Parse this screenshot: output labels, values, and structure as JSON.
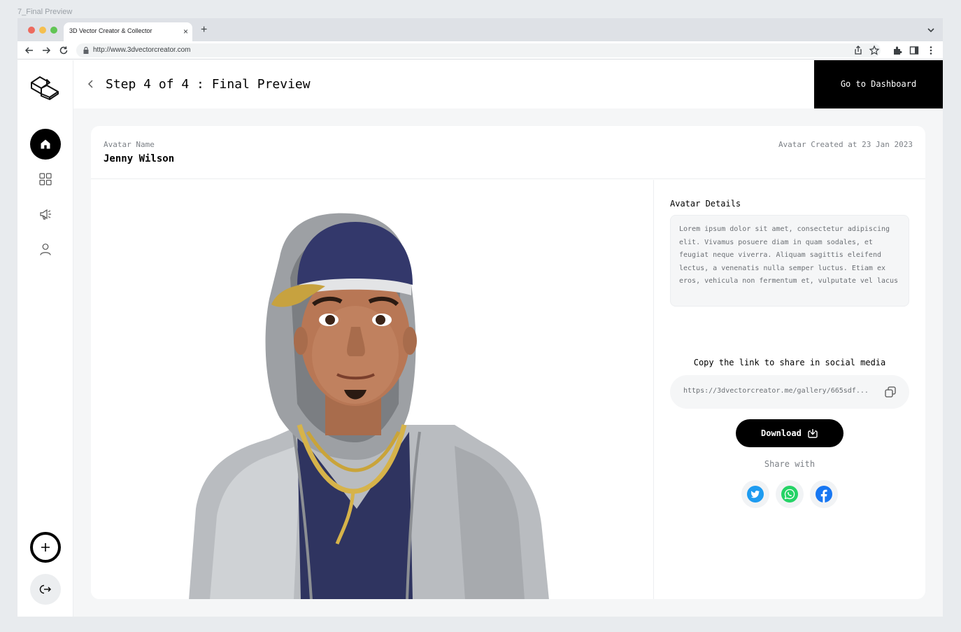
{
  "frame_label": "7_Final Preview",
  "browser": {
    "tab_title": "3D Vector Creator & Collector",
    "tab_close": "×",
    "new_tab": "+",
    "url": "http://www.3dvectorcreator.com"
  },
  "colors": {
    "accent": "#000000",
    "background": "#f5f6f7",
    "twitter": "#1d9bf0",
    "whatsapp": "#25d366",
    "facebook": "#1877f2"
  },
  "sidebar": {
    "items": [
      {
        "icon": "home-icon",
        "active": true
      },
      {
        "icon": "grid-icon",
        "active": false
      },
      {
        "icon": "megaphone-icon",
        "active": false
      },
      {
        "icon": "user-icon",
        "active": false
      }
    ],
    "add_icon": "plus-icon",
    "logout_icon": "logout-icon"
  },
  "header": {
    "title": "Step 4 of 4 : Final Preview",
    "dashboard_button": "Go to Dashboard"
  },
  "avatar": {
    "name_label": "Avatar Name",
    "name": "Jenny Wilson",
    "created": "Avatar Created at 23 Jan 2023"
  },
  "details": {
    "title": "Avatar Details",
    "description": "Lorem ipsum dolor sit amet, consectetur adipiscing elit. Vivamus posuere diam in quam sodales, et feugiat neque viverra. Aliquam sagittis eleifend lectus, a venenatis nulla semper luctus. Etiam ex eros, vehicula non fermentum et, vulputate vel lacus",
    "share_prompt": "Copy the link to share in social media",
    "share_link": "https://3dvectorcreator.me/gallery/665sdf...",
    "download_label": "Download",
    "share_with": "Share with"
  }
}
